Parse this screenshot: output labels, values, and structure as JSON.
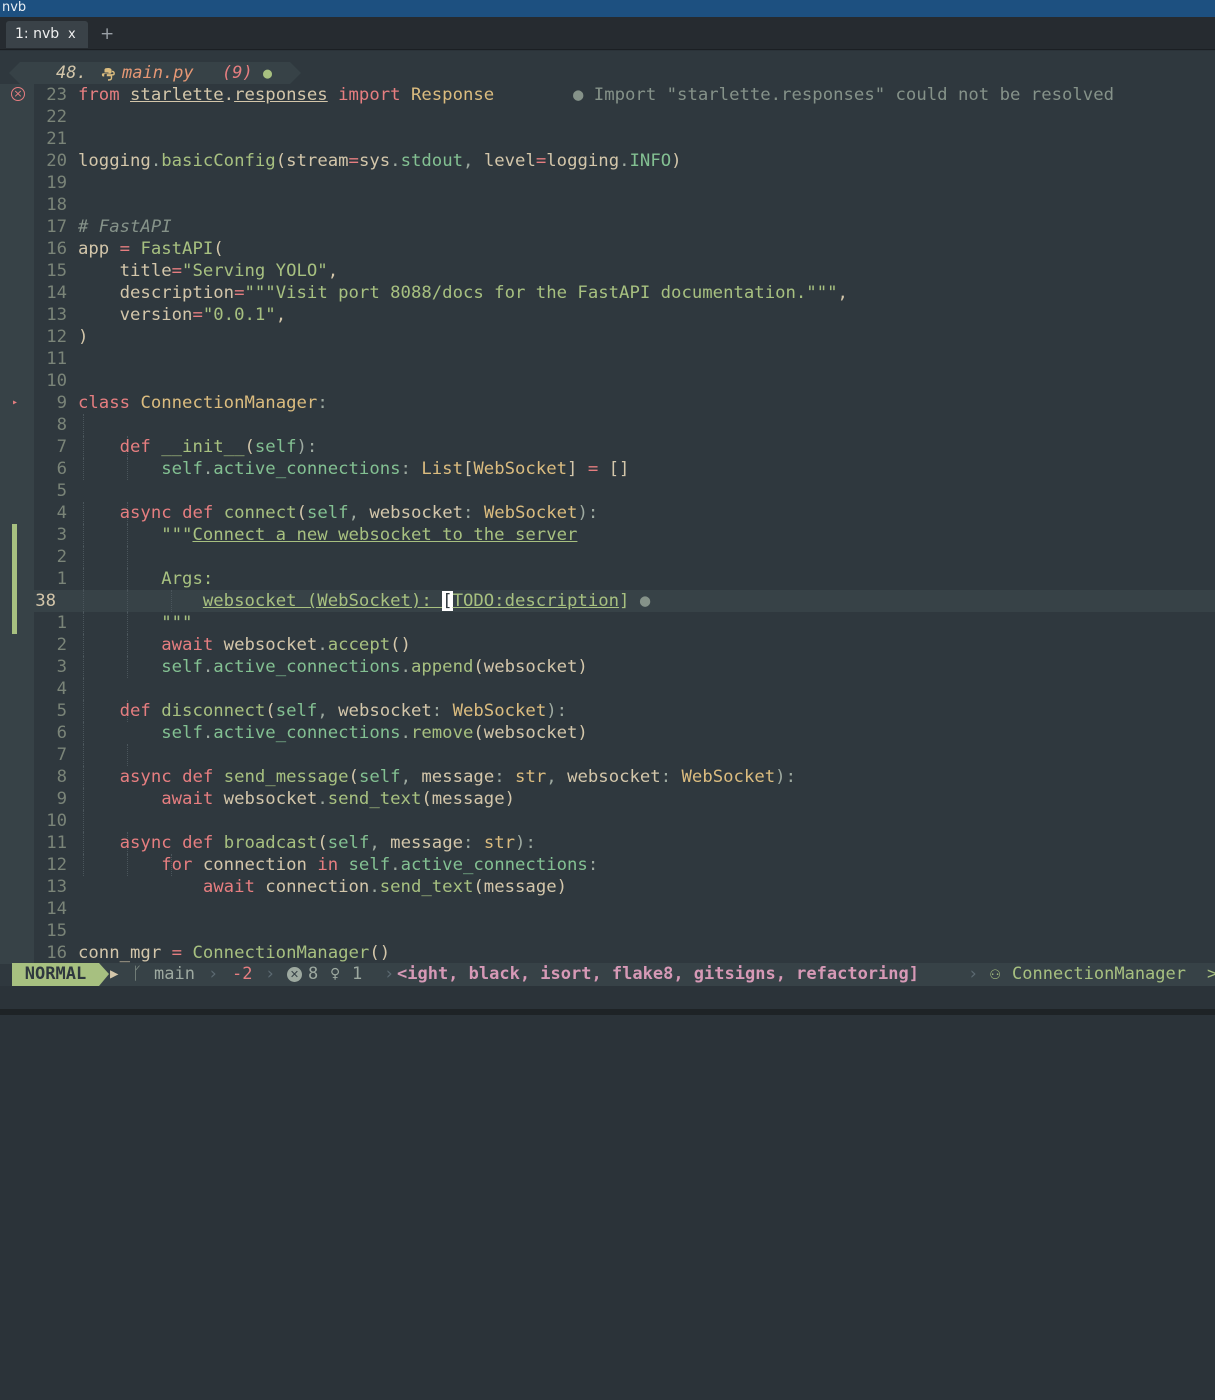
{
  "window": {
    "title": "nvb"
  },
  "tabs": [
    {
      "label": "1: nvb",
      "close": "x"
    }
  ],
  "tabbar": {
    "new_tab": "+"
  },
  "winbar": {
    "count": "48.",
    "filename": "main.py",
    "diag_count": "(9)",
    "modified": "●",
    "file_icon": "python-icon"
  },
  "diagnostic": {
    "message": "● Import \"starlette.responses\" could not be resolved"
  },
  "editor": {
    "lines": [
      {
        "num": "23",
        "sign": "error",
        "tokens": [
          {
            "t": "from",
            "c": "k"
          },
          {
            "t": " "
          },
          {
            "t": "starlette",
            "c": "u"
          },
          {
            "t": "."
          },
          {
            "t": "responses",
            "c": "u"
          },
          {
            "t": " "
          },
          {
            "t": "import",
            "c": "k"
          },
          {
            "t": " "
          },
          {
            "t": "Response",
            "c": "y"
          }
        ]
      },
      {
        "num": "22",
        "tokens": []
      },
      {
        "num": "21",
        "tokens": []
      },
      {
        "num": "20",
        "tokens": [
          {
            "t": "logging"
          },
          {
            "t": ".",
            "c": "g"
          },
          {
            "t": "basicConfig",
            "c": "s"
          },
          {
            "t": "(stream"
          },
          {
            "t": "=",
            "c": "k"
          },
          {
            "t": "sys"
          },
          {
            "t": ".",
            "c": "g"
          },
          {
            "t": "stdout",
            "c": "b"
          },
          {
            "t": ", ",
            "c": "g"
          },
          {
            "t": "level"
          },
          {
            "t": "=",
            "c": "k"
          },
          {
            "t": "logging"
          },
          {
            "t": ".",
            "c": "g"
          },
          {
            "t": "INFO",
            "c": "b"
          },
          {
            "t": ")"
          }
        ]
      },
      {
        "num": "19",
        "tokens": []
      },
      {
        "num": "18",
        "tokens": []
      },
      {
        "num": "17",
        "tokens": [
          {
            "t": "# FastAPI",
            "c": "c"
          }
        ]
      },
      {
        "num": "16",
        "tokens": [
          {
            "t": "app "
          },
          {
            "t": "=",
            "c": "k"
          },
          {
            "t": " "
          },
          {
            "t": "FastAPI",
            "c": "s"
          },
          {
            "t": "("
          }
        ]
      },
      {
        "num": "15",
        "tokens": [
          {
            "t": "    title"
          },
          {
            "t": "=",
            "c": "k"
          },
          {
            "t": "\"Serving YOLO\"",
            "c": "s"
          },
          {
            "t": ","
          }
        ]
      },
      {
        "num": "14",
        "tokens": [
          {
            "t": "    description"
          },
          {
            "t": "=",
            "c": "k"
          },
          {
            "t": "\"\"\"Visit port 8088/docs for the FastAPI documentation.\"\"\"",
            "c": "s"
          },
          {
            "t": ","
          }
        ]
      },
      {
        "num": "13",
        "tokens": [
          {
            "t": "    version"
          },
          {
            "t": "=",
            "c": "k"
          },
          {
            "t": "\"0.0.1\"",
            "c": "s"
          },
          {
            "t": ","
          }
        ]
      },
      {
        "num": "12",
        "tokens": [
          {
            "t": ")"
          }
        ]
      },
      {
        "num": "11",
        "tokens": []
      },
      {
        "num": "10",
        "tokens": []
      },
      {
        "num": "9",
        "sign": "fold",
        "tokens": [
          {
            "t": "class",
            "c": "k"
          },
          {
            "t": " "
          },
          {
            "t": "ConnectionManager",
            "c": "y"
          },
          {
            "t": ":",
            "c": "g"
          }
        ]
      },
      {
        "num": "8",
        "tokens": []
      },
      {
        "num": "7",
        "tokens": [
          {
            "t": "    "
          },
          {
            "t": "def",
            "c": "k"
          },
          {
            "t": " "
          },
          {
            "t": "__init__",
            "c": "s"
          },
          {
            "t": "("
          },
          {
            "t": "self",
            "c": "b"
          },
          {
            "t": "):",
            "c": "g"
          }
        ]
      },
      {
        "num": "6",
        "tokens": [
          {
            "t": "        "
          },
          {
            "t": "self",
            "c": "b"
          },
          {
            "t": ".",
            "c": "g"
          },
          {
            "t": "active_connections",
            "c": "b"
          },
          {
            "t": ": ",
            "c": "g"
          },
          {
            "t": "List",
            "c": "y"
          },
          {
            "t": "["
          },
          {
            "t": "WebSocket",
            "c": "y"
          },
          {
            "t": "] "
          },
          {
            "t": "=",
            "c": "k"
          },
          {
            "t": " []"
          }
        ]
      },
      {
        "num": "5",
        "tokens": []
      },
      {
        "num": "4",
        "tokens": [
          {
            "t": "    "
          },
          {
            "t": "async",
            "c": "k"
          },
          {
            "t": " "
          },
          {
            "t": "def",
            "c": "k"
          },
          {
            "t": " "
          },
          {
            "t": "connect",
            "c": "s"
          },
          {
            "t": "("
          },
          {
            "t": "self",
            "c": "b"
          },
          {
            "t": ", ",
            "c": "g"
          },
          {
            "t": "websocket"
          },
          {
            "t": ": ",
            "c": "g"
          },
          {
            "t": "WebSocket",
            "c": "y"
          },
          {
            "t": "):",
            "c": "g"
          }
        ]
      },
      {
        "num": "3",
        "git": true,
        "tokens": [
          {
            "t": "        "
          },
          {
            "t": "\"\"\"",
            "c": "s"
          },
          {
            "t": "Connect a new websocket to the server",
            "c": "s u"
          }
        ]
      },
      {
        "num": "2",
        "git": true,
        "tokens": []
      },
      {
        "num": "1",
        "git": true,
        "tokens": [
          {
            "t": "        "
          },
          {
            "t": "Args:",
            "c": "s"
          }
        ]
      },
      {
        "num": "38",
        "git": true,
        "current": true,
        "tokens": [
          {
            "t": "            "
          },
          {
            "t": "websocket (WebSocket): ",
            "c": "s u"
          },
          {
            "t": "[",
            "c": "cursor"
          },
          {
            "t": "TODO:description",
            "c": "s u"
          },
          {
            "t": "]",
            "c": "s"
          },
          {
            "t": " "
          },
          {
            "t": "●",
            "c": "bullet"
          }
        ]
      },
      {
        "num": "1",
        "git": true,
        "tokens": [
          {
            "t": "        "
          },
          {
            "t": "\"\"\"",
            "c": "s"
          }
        ]
      },
      {
        "num": "2",
        "tokens": [
          {
            "t": "        "
          },
          {
            "t": "await",
            "c": "k"
          },
          {
            "t": " websocket"
          },
          {
            "t": ".",
            "c": "g"
          },
          {
            "t": "accept",
            "c": "s"
          },
          {
            "t": "()"
          }
        ]
      },
      {
        "num": "3",
        "tokens": [
          {
            "t": "        "
          },
          {
            "t": "self",
            "c": "b"
          },
          {
            "t": ".",
            "c": "g"
          },
          {
            "t": "active_connections",
            "c": "b"
          },
          {
            "t": ".",
            "c": "g"
          },
          {
            "t": "append",
            "c": "s"
          },
          {
            "t": "(websocket)"
          }
        ]
      },
      {
        "num": "4",
        "tokens": []
      },
      {
        "num": "5",
        "tokens": [
          {
            "t": "    "
          },
          {
            "t": "def",
            "c": "k"
          },
          {
            "t": " "
          },
          {
            "t": "disconnect",
            "c": "s"
          },
          {
            "t": "("
          },
          {
            "t": "self",
            "c": "b"
          },
          {
            "t": ", ",
            "c": "g"
          },
          {
            "t": "websocket"
          },
          {
            "t": ": ",
            "c": "g"
          },
          {
            "t": "WebSocket",
            "c": "y"
          },
          {
            "t": "):",
            "c": "g"
          }
        ]
      },
      {
        "num": "6",
        "tokens": [
          {
            "t": "        "
          },
          {
            "t": "self",
            "c": "b"
          },
          {
            "t": ".",
            "c": "g"
          },
          {
            "t": "active_connections",
            "c": "b"
          },
          {
            "t": ".",
            "c": "g"
          },
          {
            "t": "remove",
            "c": "s"
          },
          {
            "t": "(websocket)"
          }
        ]
      },
      {
        "num": "7",
        "tokens": []
      },
      {
        "num": "8",
        "tokens": [
          {
            "t": "    "
          },
          {
            "t": "async",
            "c": "k"
          },
          {
            "t": " "
          },
          {
            "t": "def",
            "c": "k"
          },
          {
            "t": " "
          },
          {
            "t": "send_message",
            "c": "s"
          },
          {
            "t": "("
          },
          {
            "t": "self",
            "c": "b"
          },
          {
            "t": ", ",
            "c": "g"
          },
          {
            "t": "message"
          },
          {
            "t": ": ",
            "c": "g"
          },
          {
            "t": "str",
            "c": "y"
          },
          {
            "t": ", ",
            "c": "g"
          },
          {
            "t": "websocket"
          },
          {
            "t": ": ",
            "c": "g"
          },
          {
            "t": "WebSocket",
            "c": "y"
          },
          {
            "t": "):",
            "c": "g"
          }
        ]
      },
      {
        "num": "9",
        "tokens": [
          {
            "t": "        "
          },
          {
            "t": "await",
            "c": "k"
          },
          {
            "t": " websocket"
          },
          {
            "t": ".",
            "c": "g"
          },
          {
            "t": "send_text",
            "c": "s"
          },
          {
            "t": "(message)"
          }
        ]
      },
      {
        "num": "10",
        "tokens": []
      },
      {
        "num": "11",
        "tokens": [
          {
            "t": "    "
          },
          {
            "t": "async",
            "c": "k"
          },
          {
            "t": " "
          },
          {
            "t": "def",
            "c": "k"
          },
          {
            "t": " "
          },
          {
            "t": "broadcast",
            "c": "s"
          },
          {
            "t": "("
          },
          {
            "t": "self",
            "c": "b"
          },
          {
            "t": ", ",
            "c": "g"
          },
          {
            "t": "message"
          },
          {
            "t": ": ",
            "c": "g"
          },
          {
            "t": "str",
            "c": "y"
          },
          {
            "t": "):",
            "c": "g"
          }
        ]
      },
      {
        "num": "12",
        "tokens": [
          {
            "t": "        "
          },
          {
            "t": "for",
            "c": "k"
          },
          {
            "t": " connection "
          },
          {
            "t": "in",
            "c": "k"
          },
          {
            "t": " "
          },
          {
            "t": "self",
            "c": "b"
          },
          {
            "t": ".",
            "c": "g"
          },
          {
            "t": "active_connections",
            "c": "b"
          },
          {
            "t": ":",
            "c": "g"
          }
        ]
      },
      {
        "num": "13",
        "tokens": [
          {
            "t": "            "
          },
          {
            "t": "await",
            "c": "k"
          },
          {
            "t": " connection"
          },
          {
            "t": ".",
            "c": "g"
          },
          {
            "t": "send_text",
            "c": "s"
          },
          {
            "t": "(message)"
          }
        ]
      },
      {
        "num": "14",
        "tokens": []
      },
      {
        "num": "15",
        "tokens": []
      },
      {
        "num": "16",
        "tokens": [
          {
            "t": "conn_mgr "
          },
          {
            "t": "=",
            "c": "k"
          },
          {
            "t": " "
          },
          {
            "t": "ConnectionManager",
            "c": "s"
          },
          {
            "t": "()"
          }
        ]
      }
    ]
  },
  "statusline": {
    "mode": "NORMAL",
    "branch_icon": "git-branch-icon",
    "branch": "main",
    "diff": "-2",
    "errors": "8",
    "hints": "1",
    "clients": "<ight, black, isort, flake8, gitsigns, refactoring]",
    "context_icon": "structure-icon",
    "context": "ConnectionManager",
    "tail": ">"
  },
  "colors": {
    "mode_bg": "#a7c080",
    "error": "#e67e80",
    "string": "#a7c080",
    "keyword": "#e67e80",
    "type": "#dbbc7f",
    "member": "#83c092",
    "clients": "#d699b6"
  }
}
